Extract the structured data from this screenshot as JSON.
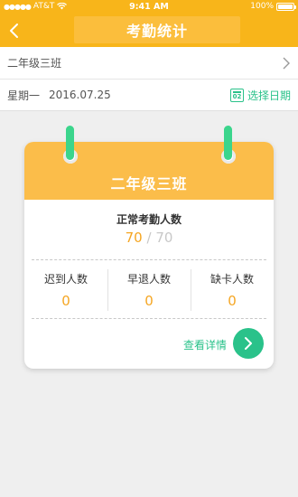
{
  "status_bar": {
    "carrier": "AT&T",
    "time": "9:41 AM",
    "battery": "100%"
  },
  "nav": {
    "title": "考勤统计"
  },
  "class_row": {
    "name": "二年级三班"
  },
  "date_row": {
    "weekday": "星期一",
    "date": "2016.07.25",
    "calendar_day": "02",
    "pick_label": "选择日期"
  },
  "card": {
    "title": "二年级三班",
    "normal_label": "正常考勤人数",
    "normal_count": "70",
    "normal_separator": "/",
    "normal_total": "70",
    "stats": [
      {
        "label": "迟到人数",
        "value": "0"
      },
      {
        "label": "早退人数",
        "value": "0"
      },
      {
        "label": "缺卡人数",
        "value": "0"
      }
    ],
    "details_label": "查看详情"
  },
  "colors": {
    "primary": "#f8b51a",
    "card_header": "#fbbd4a",
    "accent_green": "#2ac28a",
    "value_orange": "#f5a623"
  },
  "icons": [
    "back-arrow-icon",
    "chevron-right-icon",
    "calendar-icon",
    "arrow-right-icon",
    "wifi-icon",
    "signal-icon",
    "battery-icon"
  ]
}
